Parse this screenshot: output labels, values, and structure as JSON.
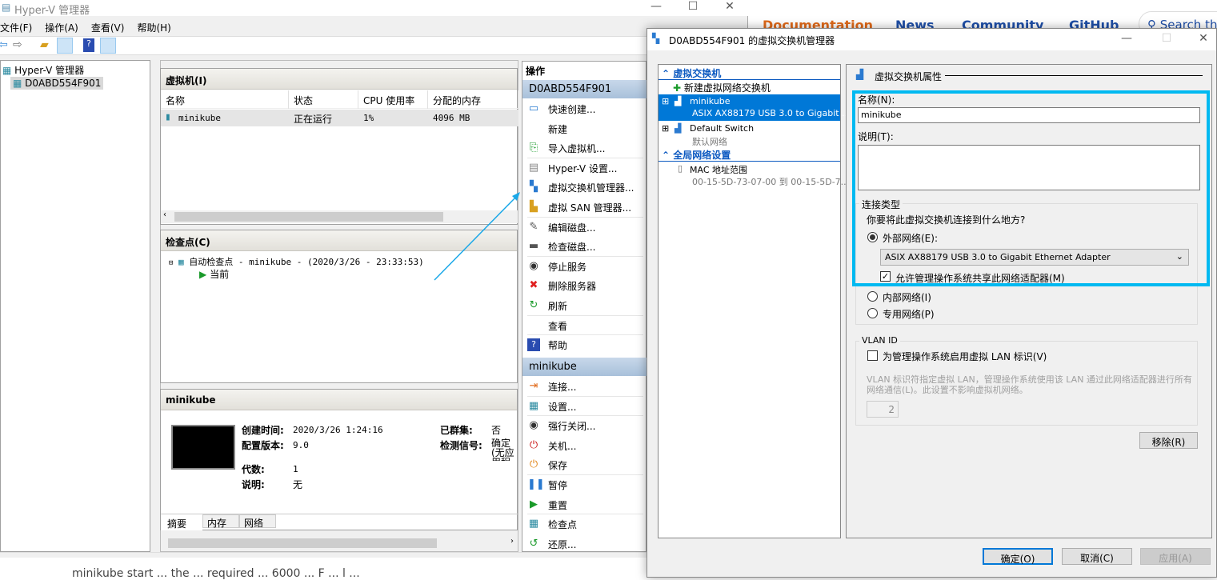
{
  "web": {
    "nav": [
      "Documentation",
      "News",
      "Community",
      "GitHub"
    ],
    "search_placeholder": "Search th",
    "footer_text": "minikube start ... the ... required ... 6000 ... F ... l ..."
  },
  "main": {
    "title": "Hyper-V 管理器",
    "menu": [
      "文件(F)",
      "操作(A)",
      "查看(V)",
      "帮助(H)"
    ],
    "tree": {
      "root": "Hyper-V 管理器",
      "host": "D0ABD554F901"
    },
    "vm_panel": {
      "title": "虚拟机(I)",
      "columns": [
        "名称",
        "状态",
        "CPU 使用率",
        "分配的内存"
      ],
      "rows": [
        {
          "name": "minikube",
          "state": "正在运行",
          "cpu": "1%",
          "memory": "4096 MB"
        }
      ]
    },
    "checkpoint_panel": {
      "title": "检查点(C)",
      "items": [
        "自动检查点 - minikube - (2020/3/26 - 23:33:53)",
        "当前"
      ]
    },
    "details": {
      "title": "minikube",
      "created_label": "创建时间:",
      "created": "2020/3/26 1:24:16",
      "config_label": "配置版本:",
      "config": "9.0",
      "gen_label": "代数:",
      "gen": "1",
      "desc_label": "说明:",
      "desc": "无",
      "clustered_label": "已群集:",
      "clustered": "否",
      "heartbeat_label": "检测信号:",
      "heartbeat": "确定(无应用程序数据)",
      "tabs": [
        "摘要",
        "内存",
        "网络"
      ]
    },
    "actions": {
      "title": "操作",
      "host_group": "D0ABD554F901",
      "host_items": [
        {
          "label": "快速创建...",
          "icon": "quick-create-icon"
        },
        {
          "label": "新建",
          "icon": ""
        },
        {
          "label": "导入虚拟机...",
          "icon": "import-icon"
        },
        {
          "label": "Hyper-V 设置...",
          "icon": "settings-icon"
        },
        {
          "label": "虚拟交换机管理器...",
          "icon": "switch-manager-icon"
        },
        {
          "label": "虚拟 SAN 管理器...",
          "icon": "san-icon"
        },
        {
          "label": "编辑磁盘...",
          "icon": "edit-disk-icon"
        },
        {
          "label": "检查磁盘...",
          "icon": "inspect-disk-icon"
        },
        {
          "label": "停止服务",
          "icon": "stop-icon"
        },
        {
          "label": "删除服务器",
          "icon": "delete-icon"
        },
        {
          "label": "刷新",
          "icon": "refresh-icon"
        },
        {
          "label": "查看",
          "icon": ""
        },
        {
          "label": "帮助",
          "icon": "help-icon"
        }
      ],
      "vm_group": "minikube",
      "vm_items": [
        {
          "label": "连接...",
          "icon": "connect-icon"
        },
        {
          "label": "设置...",
          "icon": "vm-settings-icon"
        },
        {
          "label": "强行关闭...",
          "icon": "turn-off-icon"
        },
        {
          "label": "关机...",
          "icon": "shutdown-icon"
        },
        {
          "label": "保存",
          "icon": "save-icon"
        },
        {
          "label": "暂停",
          "icon": "pause-icon"
        },
        {
          "label": "重置",
          "icon": "reset-icon"
        },
        {
          "label": "检查点",
          "icon": "checkpoint-icon"
        },
        {
          "label": "还原...",
          "icon": "revert-icon"
        }
      ]
    }
  },
  "dialog": {
    "title": "D0ABD554F901 的虚拟交换机管理器",
    "tree": {
      "section1": "虚拟交换机",
      "new_switch": "新建虚拟网络交换机",
      "switches": [
        {
          "name": "minikube",
          "sub": "ASIX AX88179 USB 3.0 to Gigabit ...",
          "selected": true
        },
        {
          "name": "Default Switch",
          "sub": "默认网络",
          "selected": false
        }
      ],
      "section2": "全局网络设置",
      "mac_label": "MAC 地址范围",
      "mac_value": "00-15-5D-73-07-00 到 00-15-5D-7..."
    },
    "props": {
      "title": "虚拟交换机属性",
      "name_label": "名称(N):",
      "name_value": "minikube",
      "desc_label": "说明(T):",
      "desc_value": "",
      "conn_group": "连接类型",
      "conn_question": "你要将此虚拟交换机连接到什么地方?",
      "external": "外部网络(E):",
      "adapter": "ASIX AX88179 USB 3.0 to Gigabit Ethernet Adapter",
      "allow_share": "允许管理操作系统共享此网络适配器(M)",
      "allow_share_checked": true,
      "internal": "内部网络(I)",
      "private": "专用网络(P)",
      "selected_type": "external",
      "vlan_group": "VLAN ID",
      "vlan_enable": "为管理操作系统启用虚拟 LAN 标识(V)",
      "vlan_enable_checked": false,
      "vlan_help": "VLAN 标识符指定虚拟 LAN，管理操作系统使用该 LAN 通过此网络适配器进行所有网络通信(L)。此设置不影响虚拟机网络。",
      "vlan_value": "2",
      "remove": "移除(R)"
    },
    "buttons": {
      "ok": "确定(O)",
      "cancel": "取消(C)",
      "apply": "应用(A)"
    },
    "highlight_color": "#00b9f1"
  }
}
